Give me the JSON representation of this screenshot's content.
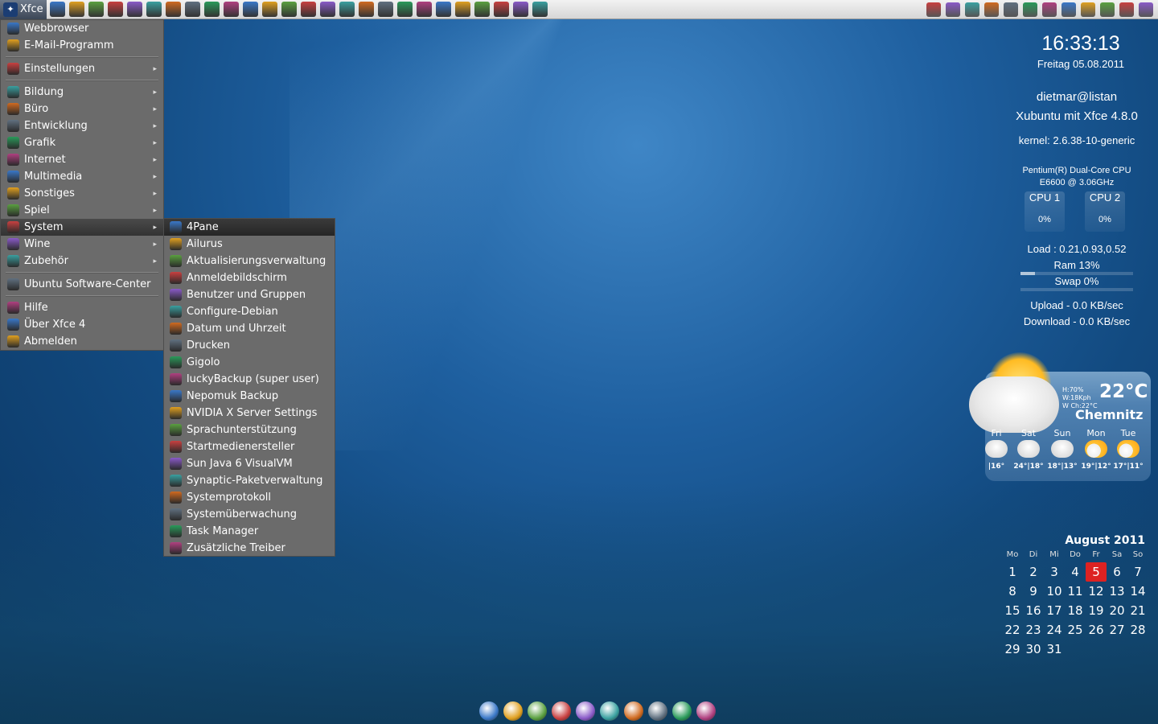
{
  "panel": {
    "menu_button_label": "Xfce",
    "launcher_icons": [
      "terminal-icon",
      "settings-icon",
      "text-editor-icon",
      "files-icon",
      "firefox-icon",
      "ailurus-icon",
      "monitor-icon",
      "network-icon",
      "search-icon",
      "t-icon",
      "p-icon",
      "s-icon",
      "chat-icon",
      "opera-icon",
      "calendar-icon",
      "palette-icon",
      "image-icon",
      "doc-icon",
      "car-icon",
      "network-tool-icon",
      "globe-icon",
      "vlc-icon",
      "music-icon",
      "game-icon",
      "people-icon",
      "app-icon"
    ],
    "tray_icons": [
      "printer-icon",
      "calc-icon",
      "camera-icon",
      "pdf-icon",
      "linux-icon",
      "keyboard-icon",
      "window-icon",
      "redhat-icon",
      "hp-icon",
      "network-updown-icon",
      "clipboard-icon",
      "volume-icon"
    ]
  },
  "menu": {
    "items": [
      {
        "label": "Webbrowser",
        "icon": "web-icon",
        "arrow": false
      },
      {
        "label": "E-Mail-Programm",
        "icon": "mail-icon",
        "arrow": false
      },
      {
        "sep": true
      },
      {
        "label": "Einstellungen",
        "icon": "settings-icon",
        "arrow": true
      },
      {
        "sep": true
      },
      {
        "label": "Bildung",
        "icon": "education-icon",
        "arrow": true
      },
      {
        "label": "Büro",
        "icon": "office-icon",
        "arrow": true
      },
      {
        "label": "Entwicklung",
        "icon": "development-icon",
        "arrow": true
      },
      {
        "label": "Grafik",
        "icon": "graphics-icon",
        "arrow": true
      },
      {
        "label": "Internet",
        "icon": "internet-icon",
        "arrow": true
      },
      {
        "label": "Multimedia",
        "icon": "multimedia-icon",
        "arrow": true
      },
      {
        "label": "Sonstiges",
        "icon": "misc-icon",
        "arrow": true
      },
      {
        "label": "Spiel",
        "icon": "game-icon",
        "arrow": true
      },
      {
        "label": "System",
        "icon": "system-gear-icon",
        "arrow": true,
        "active": true
      },
      {
        "label": "Wine",
        "icon": "wine-icon",
        "arrow": true
      },
      {
        "label": "Zubehör",
        "icon": "accessories-icon",
        "arrow": true
      },
      {
        "sep": true
      },
      {
        "label": "Ubuntu Software-Center",
        "icon": "software-center-icon",
        "arrow": false
      },
      {
        "sep": true
      },
      {
        "label": "Hilfe",
        "icon": "help-icon",
        "arrow": false
      },
      {
        "label": "Über Xfce 4",
        "icon": "star-icon",
        "arrow": false
      },
      {
        "label": "Abmelden",
        "icon": "logout-icon",
        "arrow": false
      }
    ]
  },
  "submenu": {
    "items": [
      {
        "label": "4Pane",
        "icon": "4pane-icon",
        "active": true
      },
      {
        "label": "Ailurus",
        "icon": "ailurus-icon"
      },
      {
        "label": "Aktualisierungsverwaltung",
        "icon": "update-icon"
      },
      {
        "label": "Anmeldebildschirm",
        "icon": "login-screen-icon"
      },
      {
        "label": "Benutzer und Gruppen",
        "icon": "users-icon"
      },
      {
        "label": "Configure-Debian",
        "icon": "debian-icon"
      },
      {
        "label": "Datum und Uhrzeit",
        "icon": "clock-icon"
      },
      {
        "label": "Drucken",
        "icon": "printer-icon"
      },
      {
        "label": "Gigolo",
        "icon": "gigolo-icon"
      },
      {
        "label": "luckyBackup (super user)",
        "icon": "backup-icon"
      },
      {
        "label": "Nepomuk Backup",
        "icon": "nepomuk-icon"
      },
      {
        "label": "NVIDIA X Server Settings",
        "icon": "nvidia-icon"
      },
      {
        "label": "Sprachunterstützung",
        "icon": "language-icon"
      },
      {
        "label": "Startmedienersteller",
        "icon": "usb-creator-icon"
      },
      {
        "label": "Sun Java 6 VisualVM",
        "icon": "java-icon"
      },
      {
        "label": "Synaptic-Paketverwaltung",
        "icon": "synaptic-icon"
      },
      {
        "label": "Systemprotokoll",
        "icon": "log-icon"
      },
      {
        "label": "Systemüberwachung",
        "icon": "monitor-icon"
      },
      {
        "label": "Task Manager",
        "icon": "task-manager-icon"
      },
      {
        "label": "Zusätzliche Treiber",
        "icon": "drivers-icon"
      }
    ]
  },
  "conky": {
    "time": "16:33:13",
    "date": "Freitag 05.08.2011",
    "user": "dietmar@listan",
    "distro": "Xubuntu mit Xfce 4.8.0",
    "kernel": "kernel: 2.6.38-10-generic",
    "cpu_model_1": "Pentium(R) Dual-Core  CPU",
    "cpu_model_2": "E6600  @ 3.06GHz",
    "cpu1_label": "CPU 1",
    "cpu1_pct": "0%",
    "cpu2_label": "CPU 2",
    "cpu2_pct": "0%",
    "load": "Load : 0.21,0.93,0.52",
    "ram": "Ram 13%",
    "ram_fraction": 0.13,
    "swap": "Swap 0%",
    "swap_fraction": 0.0,
    "upload": "Upload - 0.0 KB/sec",
    "download": "Download - 0.0 KB/sec"
  },
  "weather": {
    "humidity": "H:70%",
    "wind": "W:18Kph",
    "windchill": "W Ch:22°C",
    "temp": "22°C",
    "city": "Chemnitz",
    "forecast": [
      {
        "day": "Fri",
        "temp": "|16°",
        "icon": "rain-icon"
      },
      {
        "day": "Sat",
        "temp": "24°|18°",
        "icon": "cloud-icon"
      },
      {
        "day": "Sun",
        "temp": "18°|13°",
        "icon": "rain-icon"
      },
      {
        "day": "Mon",
        "temp": "19°|12°",
        "icon": "partly-sunny-icon"
      },
      {
        "day": "Tue",
        "temp": "17°|11°",
        "icon": "partly-sunny-icon"
      }
    ]
  },
  "calendar": {
    "title": "August 2011",
    "weekdays": [
      "Mo",
      "Di",
      "Mi",
      "Do",
      "Fr",
      "Sa",
      "So"
    ],
    "weeks": [
      [
        "1",
        "2",
        "3",
        "4",
        "5",
        "6",
        "7"
      ],
      [
        "8",
        "9",
        "10",
        "11",
        "12",
        "13",
        "14"
      ],
      [
        "15",
        "16",
        "17",
        "18",
        "19",
        "20",
        "21"
      ],
      [
        "22",
        "23",
        "24",
        "25",
        "26",
        "27",
        "28"
      ],
      [
        "29",
        "30",
        "31",
        "",
        "",
        "",
        ""
      ]
    ],
    "today": "5"
  },
  "dock": {
    "icons": [
      "chromium-icon",
      "thunderbird-icon",
      "mail-icon",
      "pen-icon",
      "opera-icon",
      "pidgin-icon",
      "ailurus-icon",
      "disk-icon",
      "network-icon",
      "display-icon"
    ]
  },
  "colors": {
    "menu_bg": "#6b6b6b",
    "active_item": "#333333",
    "today_highlight": "#dd2222"
  }
}
